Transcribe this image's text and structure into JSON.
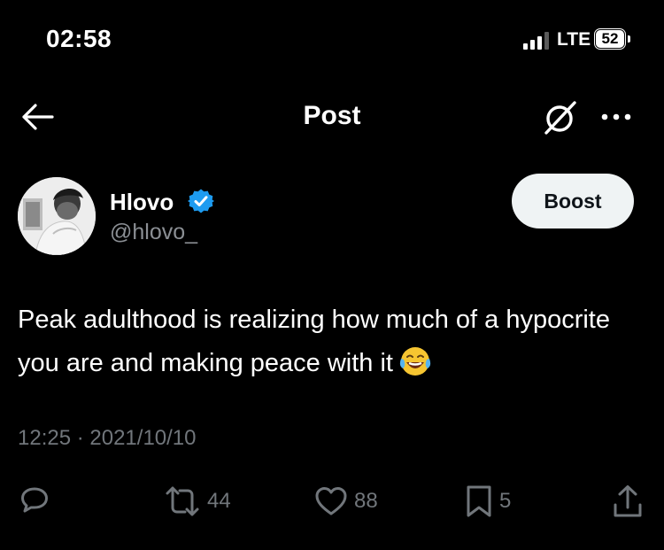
{
  "status_bar": {
    "time": "02:58",
    "network": "LTE",
    "battery": "52"
  },
  "header": {
    "title": "Post",
    "back_icon": "arrow-left-icon",
    "grok_icon": "slashed-circle-icon",
    "more_icon": "more-horizontal-icon"
  },
  "post": {
    "author_name": "Hlovo",
    "handle": "@hlovo_",
    "verified": true,
    "boost_label": "Boost",
    "text": "Peak adulthood is realizing how much of a hypocrite you are and making peace with it",
    "emoji": "😂",
    "timestamp": "12:25 · 2021/10/10"
  },
  "actions": {
    "replies": {
      "icon": "reply-icon",
      "count": ""
    },
    "reposts": {
      "icon": "repost-icon",
      "count": "44"
    },
    "likes": {
      "icon": "heart-icon",
      "count": "88"
    },
    "bookmarks": {
      "icon": "bookmark-icon",
      "count": "5"
    },
    "share": {
      "icon": "share-icon",
      "count": ""
    }
  },
  "colors": {
    "background": "#000000",
    "text": "#ffffff",
    "muted": "#71767b",
    "verified_blue": "#1d9bf0",
    "button_bg": "#eff3f4"
  }
}
